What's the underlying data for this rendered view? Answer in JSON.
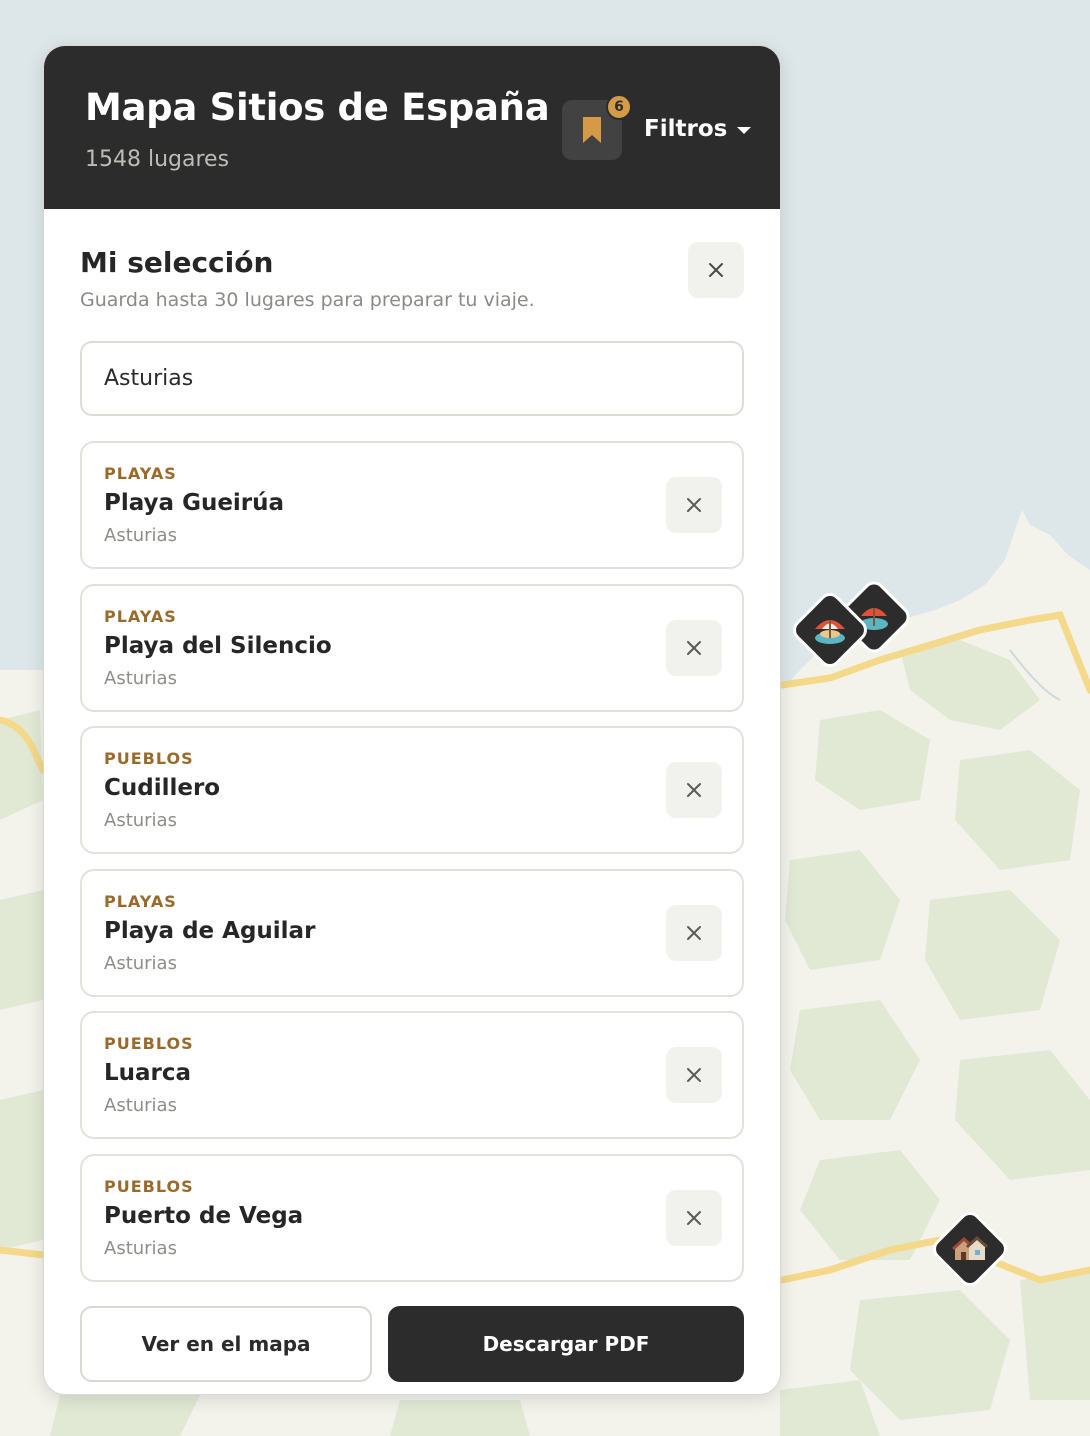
{
  "header": {
    "title": "Mapa Sitios de España",
    "count": "1548 lugares",
    "bookmark_badge": "6",
    "filters_label": "Filtros"
  },
  "selection": {
    "title": "Mi selección",
    "subtitle": "Guarda hasta 30 lugares para preparar tu viaje.",
    "search_value": "Asturias",
    "items": [
      {
        "category": "PLAYAS",
        "name": "Playa Gueirúa",
        "region": "Asturias"
      },
      {
        "category": "PLAYAS",
        "name": "Playa del Silencio",
        "region": "Asturias"
      },
      {
        "category": "PUEBLOS",
        "name": "Cudillero",
        "region": "Asturias"
      },
      {
        "category": "PLAYAS",
        "name": "Playa de Aguilar",
        "region": "Asturias"
      },
      {
        "category": "PUEBLOS",
        "name": "Luarca",
        "region": "Asturias"
      },
      {
        "category": "PUEBLOS",
        "name": "Puerto de Vega",
        "region": "Asturias"
      }
    ]
  },
  "footer": {
    "view_map_label": "Ver en el mapa",
    "download_label": "Descargar PDF"
  },
  "map": {
    "markers": [
      {
        "type": "beach",
        "icon": "beach-umbrella-icon"
      },
      {
        "type": "beach",
        "icon": "beach-umbrella-icon"
      },
      {
        "type": "village",
        "icon": "houses-icon"
      }
    ]
  },
  "colors": {
    "header_bg": "#2b2c2b",
    "accent": "#d59a45",
    "category_text": "#9a6a2b",
    "sea": "#dde6e8",
    "land": "#f3f3ec",
    "forest": "#e2ead6",
    "road": "#f4d98a"
  }
}
